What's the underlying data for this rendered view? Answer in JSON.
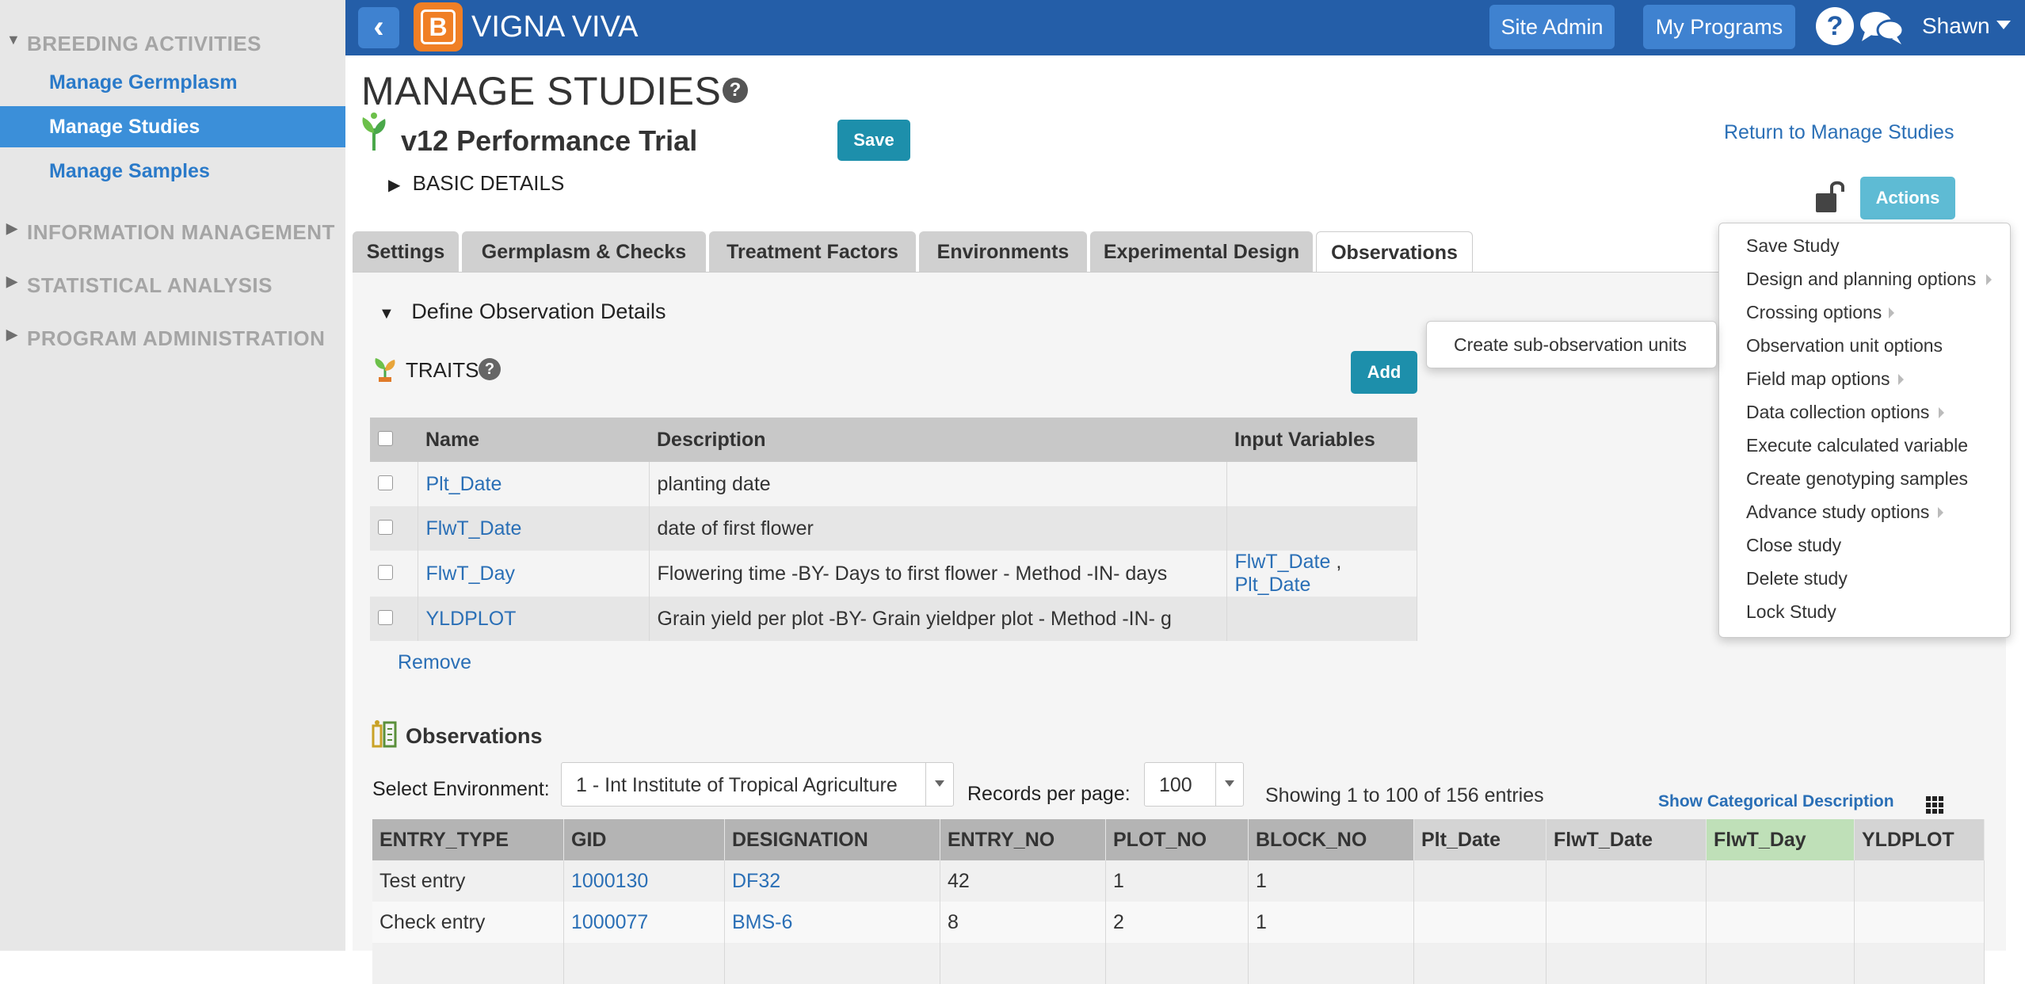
{
  "sidebar": {
    "sections": [
      {
        "label": "BREEDING ACTIVITIES",
        "expanded": true
      },
      {
        "label": "INFORMATION MANAGEMENT",
        "expanded": false
      },
      {
        "label": "STATISTICAL ANALYSIS",
        "expanded": false
      },
      {
        "label": "PROGRAM ADMINISTRATION",
        "expanded": false
      }
    ],
    "items": [
      {
        "label": "Manage Germplasm",
        "active": false
      },
      {
        "label": "Manage Studies",
        "active": true
      },
      {
        "label": "Manage Samples",
        "active": false
      }
    ]
  },
  "topbar": {
    "logo_letter": "B",
    "brand": "VIGNA VIVA",
    "site_admin": "Site Admin",
    "my_programs": "My Programs",
    "user": "Shawn"
  },
  "header": {
    "title": "MANAGE STUDIES",
    "study_name": "v12 Performance Trial",
    "save_label": "Save",
    "return_link": "Return to Manage Studies",
    "basic_details": "BASIC DETAILS",
    "actions_label": "Actions"
  },
  "tabs": [
    "Settings",
    "Germplasm & Checks",
    "Treatment Factors",
    "Environments",
    "Experimental Design",
    "Observations"
  ],
  "active_tab": "Observations",
  "define_obs": "Define Observation Details",
  "traits": {
    "title": "TRAITS",
    "add_label": "Add",
    "columns": [
      "Name",
      "Description",
      "Input Variables"
    ],
    "rows": [
      {
        "name": "Plt_Date",
        "description": "planting date",
        "inputs": []
      },
      {
        "name": "FlwT_Date",
        "description": "date of first flower",
        "inputs": []
      },
      {
        "name": "FlwT_Day",
        "description": "Flowering time -BY- Days to first flower - Method -IN- days",
        "inputs": [
          "FlwT_Date",
          "Plt_Date"
        ]
      },
      {
        "name": "YLDPLOT",
        "description": "Grain yield per plot -BY- Grain yieldper plot - Method -IN- g",
        "inputs": []
      }
    ],
    "remove_label": "Remove"
  },
  "observations": {
    "title": "Observations",
    "env_label": "Select Environment:",
    "env_value": "1 - Int Institute of Tropical Agriculture",
    "rpp_label": "Records per page:",
    "rpp_value": "100",
    "showing": "Showing 1 to 100 of 156 entries",
    "show_categorical": "Show Categorical Description",
    "columns": [
      "ENTRY_TYPE",
      "GID",
      "DESIGNATION",
      "ENTRY_NO",
      "PLOT_NO",
      "BLOCK_NO",
      "Plt_Date",
      "FlwT_Date",
      "FlwT_Day",
      "YLDPLOT"
    ],
    "rows": [
      [
        "Test entry",
        "1000130",
        "DF32",
        "42",
        "1",
        "1",
        "",
        "",
        "",
        ""
      ],
      [
        "Check entry",
        "1000077",
        "BMS-6",
        "8",
        "2",
        "1",
        "",
        "",
        "",
        ""
      ]
    ]
  },
  "actions_menu": {
    "items": [
      {
        "label": "Save Study",
        "submenu": false
      },
      {
        "label": "Design and planning options",
        "submenu": true
      },
      {
        "label": "Crossing options",
        "submenu": true
      },
      {
        "label": "Observation unit options",
        "submenu": false
      },
      {
        "label": "Field map options",
        "submenu": true
      },
      {
        "label": "Data collection options",
        "submenu": true
      },
      {
        "label": "Execute calculated variable",
        "submenu": false
      },
      {
        "label": "Create genotyping samples",
        "submenu": false
      },
      {
        "label": "Advance study options",
        "submenu": true
      },
      {
        "label": "Close study",
        "submenu": false
      },
      {
        "label": "Delete study",
        "submenu": false
      },
      {
        "label": "Lock Study",
        "submenu": false
      }
    ],
    "submenu_item": "Create sub-observation units"
  },
  "colors": {
    "topbar": "#245ea8",
    "active_sidebar": "#3b8fd9",
    "primary_button": "#1d8fab",
    "actions_button": "#5ebbd4",
    "logo": "#f07f25"
  }
}
